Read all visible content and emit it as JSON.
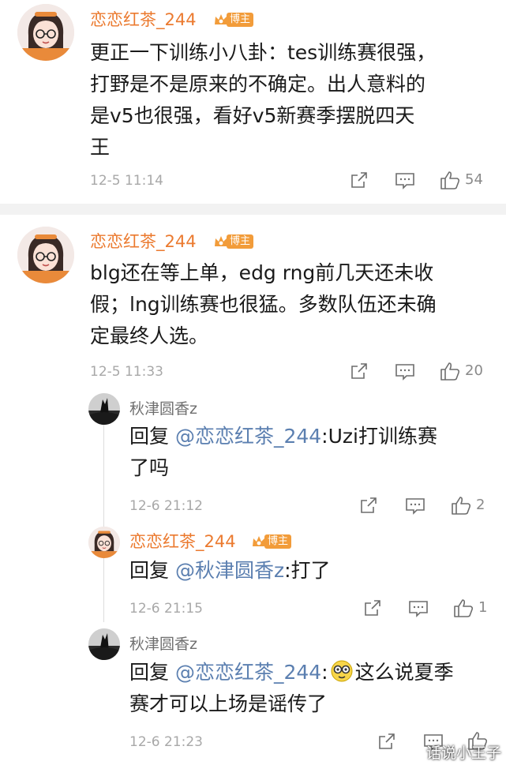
{
  "comments": [
    {
      "user": "恋恋红茶_244",
      "badge": "博主",
      "lines": [
        "更正一下训练小八卦：tes训练赛很强，",
        "打野是不是原来的不确定。出人意料的",
        "是v5也很强，看好v5新赛季摆脱四天",
        "王"
      ],
      "time": "12-5 11:14",
      "likes": "54"
    },
    {
      "user": "恋恋红茶_244",
      "badge": "博主",
      "lines": [
        "blg还在等上单，edg rng前几天还未收",
        "假；lng训练赛也很猛。多数队伍还未确",
        "定最终人选。"
      ],
      "time": "12-5 11:33",
      "likes": "20"
    }
  ],
  "replies": [
    {
      "user": "秋津圆香z",
      "reply_prefix": "回复 ",
      "mention": "@恋恋红茶_244",
      "text_line1": ":Uzi打训练赛",
      "text_line2": "了吗",
      "time": "12-6 21:12",
      "likes": "2"
    },
    {
      "user": "恋恋红茶_244",
      "badge": "博主",
      "reply_prefix": "回复 ",
      "mention": "@秋津圆香z",
      "text_line1": ":打了",
      "time": "12-6 21:15",
      "likes": "1"
    },
    {
      "user": "秋津圆香z",
      "reply_prefix": "回复 ",
      "mention": "@恋恋红茶_244",
      "text_line1": ":",
      "text_line1b": "这么说夏季",
      "text_line2": "赛才可以上场是谣传了",
      "time": "12-6 21:23"
    }
  ],
  "watermark": "话说小王子",
  "icons": {
    "share": "share-icon",
    "comment": "comment-icon",
    "like": "thumbs-up-icon",
    "emoji": "nerd-emoji-icon",
    "crown": "crown-icon"
  },
  "colors": {
    "username": "#eb7a2f",
    "mention": "#5b7fb0",
    "badge": "#f29c3a",
    "meta": "#a8a8a8"
  }
}
